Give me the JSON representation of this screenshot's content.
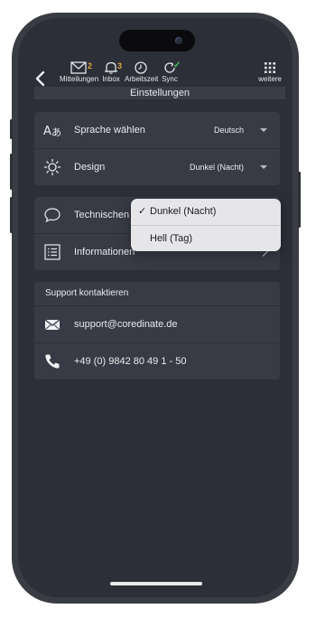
{
  "header": {
    "nav": [
      {
        "label": "Mitteilungen",
        "icon": "envelope-icon",
        "badge": "2"
      },
      {
        "label": "Inbox",
        "icon": "bell-icon",
        "badge": "3"
      },
      {
        "label": "Arbeitszeit",
        "icon": "clock-icon"
      },
      {
        "label": "Sync",
        "icon": "sync-icon",
        "status": "✓"
      },
      {
        "label": "weitere",
        "icon": "grid-icon"
      }
    ],
    "title": "Einstellungen"
  },
  "settings": {
    "language": {
      "label": "Sprache wählen",
      "value": "Deutsch",
      "icon": "translate-icon"
    },
    "design": {
      "label": "Design",
      "value": "Dunkel (Nacht)",
      "icon": "sun-icon"
    }
  },
  "info": {
    "technical": {
      "label": "Technischen",
      "icon": "chat-bubble-icon"
    },
    "informationen": {
      "label": "Informationen",
      "icon": "list-icon"
    }
  },
  "support": {
    "heading": "Support kontaktieren",
    "email": {
      "label": "support@coredinate.de",
      "icon": "mail-icon"
    },
    "phone": {
      "label": "+49 (0) 9842 80 49 1 - 50",
      "icon": "phone-icon"
    }
  },
  "design_dropdown": {
    "options": [
      {
        "label": "Dunkel (Nacht)",
        "check": "✓"
      },
      {
        "label": "Hell (Tag)"
      }
    ]
  },
  "colors": {
    "badge": "#d9a93a",
    "sync_ok": "#4fc36a",
    "background": "#2c2f38",
    "card": "#383b45"
  }
}
